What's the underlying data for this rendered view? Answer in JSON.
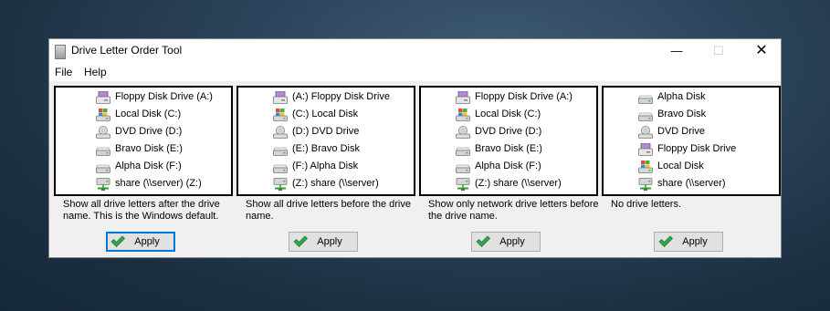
{
  "window": {
    "title": "Drive Letter Order Tool",
    "controls": {
      "minimize": "—",
      "maximize": "☐",
      "close": "✕"
    }
  },
  "menu": {
    "file": "File",
    "help": "Help"
  },
  "panels": [
    {
      "drives": [
        {
          "icon": "floppy-icon",
          "label": "Floppy Disk Drive (A:)"
        },
        {
          "icon": "windows-drive-icon",
          "label": "Local Disk (C:)"
        },
        {
          "icon": "dvd-drive-icon",
          "label": "DVD Drive (D:)"
        },
        {
          "icon": "hard-disk-icon",
          "label": "Bravo Disk (E:)"
        },
        {
          "icon": "hard-disk-icon",
          "label": "Alpha Disk (F:)"
        },
        {
          "icon": "network-drive-icon",
          "label": "share (\\\\server) (Z:)"
        }
      ],
      "description": "Show all drive letters after the drive name.  This is the Windows default.",
      "button": "Apply",
      "focused": true
    },
    {
      "drives": [
        {
          "icon": "floppy-icon",
          "label": "(A:) Floppy Disk Drive"
        },
        {
          "icon": "windows-drive-icon",
          "label": "(C:) Local Disk"
        },
        {
          "icon": "dvd-drive-icon",
          "label": "(D:) DVD Drive"
        },
        {
          "icon": "hard-disk-icon",
          "label": "(E:) Bravo Disk"
        },
        {
          "icon": "hard-disk-icon",
          "label": "(F:) Alpha Disk"
        },
        {
          "icon": "network-drive-icon",
          "label": "(Z:) share (\\\\server)"
        }
      ],
      "description": "Show all drive letters before the drive name.",
      "button": "Apply",
      "focused": false
    },
    {
      "drives": [
        {
          "icon": "floppy-icon",
          "label": "Floppy Disk Drive (A:)"
        },
        {
          "icon": "windows-drive-icon",
          "label": "Local Disk (C:)"
        },
        {
          "icon": "dvd-drive-icon",
          "label": "DVD Drive (D:)"
        },
        {
          "icon": "hard-disk-icon",
          "label": "Bravo Disk (E:)"
        },
        {
          "icon": "hard-disk-icon",
          "label": "Alpha Disk (F:)"
        },
        {
          "icon": "network-drive-icon",
          "label": "(Z:) share (\\\\server)"
        }
      ],
      "description": "Show only network drive letters before the drive name.",
      "button": "Apply",
      "focused": false
    },
    {
      "drives": [
        {
          "icon": "hard-disk-icon",
          "label": "Alpha Disk"
        },
        {
          "icon": "hard-disk-icon",
          "label": "Bravo Disk"
        },
        {
          "icon": "dvd-drive-icon",
          "label": "DVD Drive"
        },
        {
          "icon": "floppy-icon",
          "label": "Floppy Disk Drive"
        },
        {
          "icon": "windows-drive-icon",
          "label": "Local Disk"
        },
        {
          "icon": "network-drive-icon",
          "label": "share (\\\\server)"
        }
      ],
      "description": "No drive letters.",
      "button": "Apply",
      "focused": false
    }
  ]
}
